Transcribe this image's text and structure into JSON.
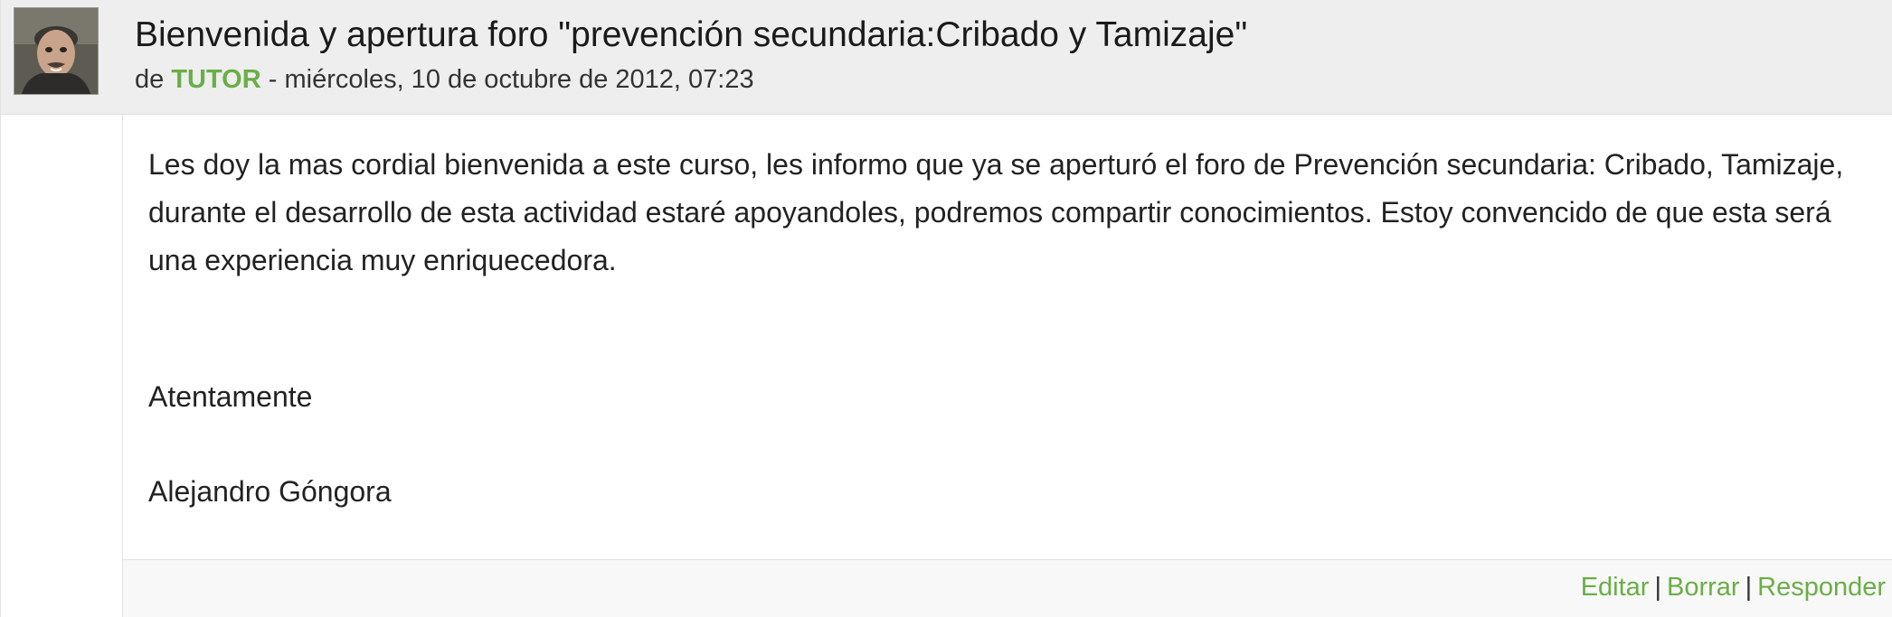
{
  "post": {
    "subject": "Bienvenida y apertura foro \"prevención secundaria:Cribado y Tamizaje\"",
    "by_prefix": "de",
    "author": "TUTOR",
    "date_separator": "-",
    "date": "miércoles, 10 de octubre de 2012, 07:23",
    "avatar_icon": "user-photo",
    "message": {
      "paragraph": "Les doy la mas cordial bienvenida a este curso, les informo que ya se aperturó el foro de Prevención secundaria: Cribado, Tamizaje, durante el desarrollo de esta actividad estaré apoyandoles, podremos compartir conocimientos. Estoy convencido de que esta será una experiencia muy enriquecedora.",
      "closing": "Atentamente",
      "signature": "Alejandro Góngora"
    },
    "commands": {
      "edit": "Editar",
      "delete": "Borrar",
      "reply": "Responder",
      "separator": "|"
    }
  },
  "colors": {
    "link": "#6aae47",
    "header_bg": "#eeeeee",
    "footer_bg": "#f8f8f8"
  }
}
